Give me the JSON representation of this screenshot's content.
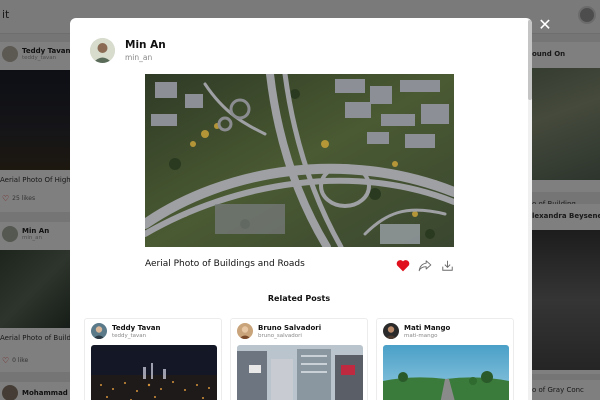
{
  "background": {
    "logo_text": "it",
    "left_column": [
      {
        "name": "Teddy Tavan",
        "handle": "teddy_tavan",
        "caption": "Aerial Photo Of High",
        "likes": "25 likes"
      },
      {
        "name": "Min An",
        "handle": "min_an",
        "caption": "Aerial Photo of Building",
        "likes": "0 like"
      },
      {
        "name": "Mohammad",
        "handle": "",
        "caption": "",
        "likes": ""
      }
    ],
    "right_column": [
      {
        "name": "ound On",
        "handle": "",
        "caption": "o of Building"
      },
      {
        "name": "lexandra Beysene",
        "handle": "",
        "caption": ""
      },
      {
        "name": "o of Gray Conc",
        "handle": "",
        "caption": ""
      }
    ]
  },
  "modal": {
    "close_symbol": "✕",
    "author": {
      "name": "Min An",
      "handle": "min_an"
    },
    "post_title": "Aerial Photo of Buildings and Roads",
    "actions": {
      "like": "heart-icon",
      "share": "share-icon",
      "download": "download-icon"
    },
    "colors": {
      "like": "#e0101c",
      "icon": "#6a6a6a"
    },
    "related_title": "Related Posts",
    "related": [
      {
        "name": "Teddy Tavan",
        "handle": "teddy_tavan"
      },
      {
        "name": "Bruno Salvadori",
        "handle": "bruno_salvadori"
      },
      {
        "name": "Mati Mango",
        "handle": "mati-mango"
      }
    ]
  }
}
